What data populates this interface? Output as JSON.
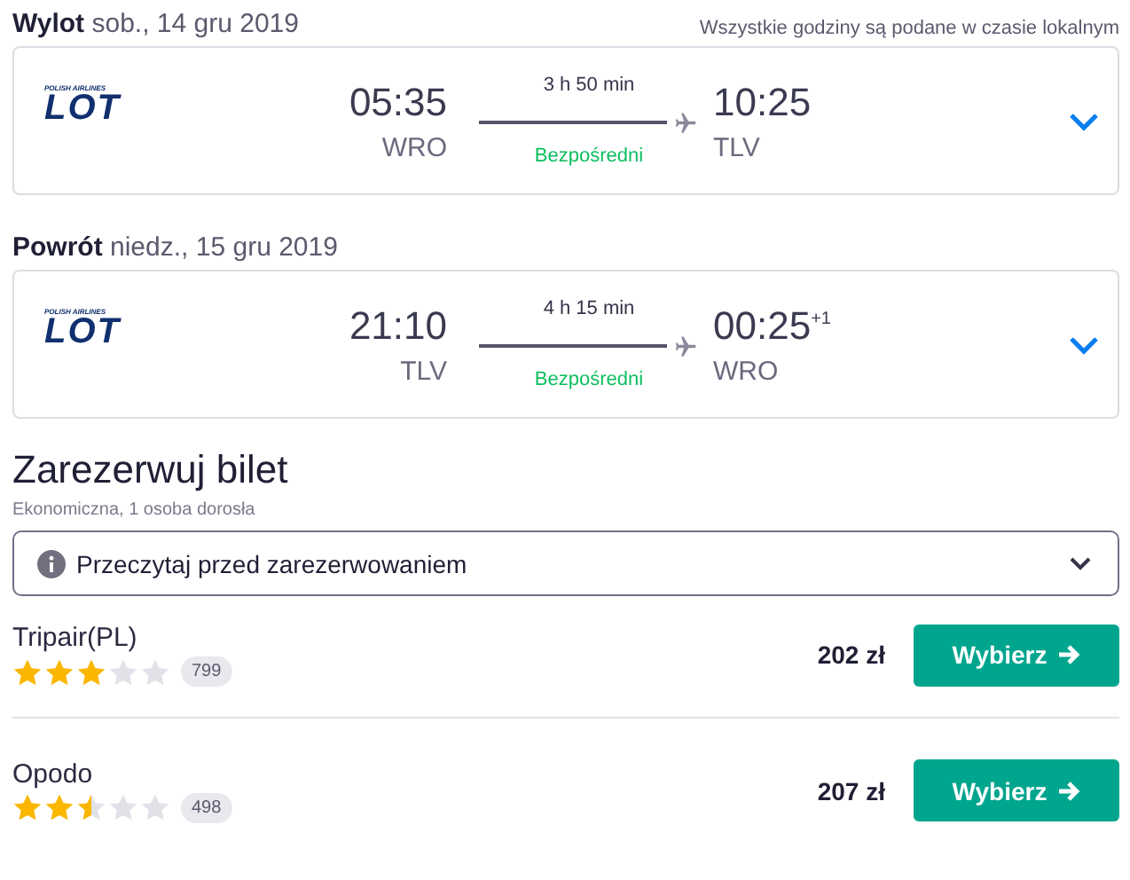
{
  "timezone_note": "Wszystkie godziny są podane w czasie lokalnym",
  "legs": [
    {
      "label": "Wylot",
      "date": "sob., 14 gru 2019",
      "airline_caption": "POLISH AIRLINES",
      "airline_logo": "LOT",
      "depart_time": "05:35",
      "depart_airport": "WRO",
      "duration": "3 h 50 min",
      "stops": "Bezpośredni",
      "arrive_time": "10:25",
      "arrive_airport": "TLV"
    },
    {
      "label": "Powrót",
      "date": "niedz., 15 gru 2019",
      "airline_caption": "POLISH AIRLINES",
      "airline_logo": "LOT",
      "depart_time": "21:10",
      "depart_airport": "TLV",
      "duration": "4 h 15 min",
      "stops": "Bezpośredni",
      "arrive_time": "00:25",
      "arrive_offset": "+1",
      "arrive_airport": "WRO"
    }
  ],
  "booking": {
    "title": "Zarezerwuj bilet",
    "subtitle": "Ekonomiczna, 1 osoba dorosła",
    "notice": "Przeczytaj przed zarezerwowaniem"
  },
  "providers": [
    {
      "name": "Tripair(PL)",
      "stars": 3,
      "reviews": "799",
      "price": "202 zł",
      "button": "Wybierz"
    },
    {
      "name": "Opodo",
      "stars": 2.5,
      "reviews": "498",
      "price": "207 zł",
      "button": "Wybierz"
    }
  ]
}
